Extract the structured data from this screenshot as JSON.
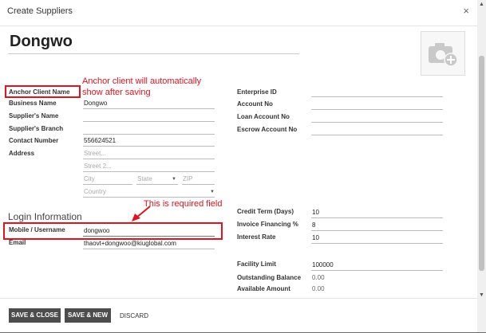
{
  "dialog": {
    "title": "Create Suppliers",
    "close_icon": "×"
  },
  "record_name": "Dongwo",
  "photo": {
    "icon": "camera-add-icon"
  },
  "left_fields": {
    "anchor_client_name": {
      "label": "Anchor Client Name",
      "value": ""
    },
    "business_name": {
      "label": "Business Name",
      "value": "Dongwo"
    },
    "suppliers_name": {
      "label": "Supplier's Name",
      "value": ""
    },
    "suppliers_branch": {
      "label": "Supplier's Branch",
      "value": ""
    },
    "contact_number": {
      "label": "Contact Number",
      "value": "556624521"
    },
    "address": {
      "label": "Address",
      "street_placeholder": "Street...",
      "street2_placeholder": "Street 2...",
      "city_placeholder": "City",
      "state_placeholder": "State",
      "zip_placeholder": "ZIP",
      "country_placeholder": "Country"
    }
  },
  "right_fields": {
    "enterprise_id": {
      "label": "Enterprise ID",
      "value": ""
    },
    "account_no": {
      "label": "Account No",
      "value": ""
    },
    "loan_account_no": {
      "label": "Loan Account No",
      "value": ""
    },
    "escrow_account_no": {
      "label": "Escrow Account No",
      "value": ""
    },
    "credit_term": {
      "label": "Credit Term (Days)",
      "value": "10"
    },
    "invoice_financing": {
      "label": "Invoice Financing %",
      "value": "8"
    },
    "interest_rate": {
      "label": "Interest Rate",
      "value": "10"
    },
    "facility_limit": {
      "label": "Facility Limit",
      "value": "100000"
    },
    "outstanding_balance": {
      "label": "Outstanding Balance",
      "value": "0.00"
    },
    "available_amount": {
      "label": "Available Amount",
      "value": "0.00"
    }
  },
  "login_section": {
    "heading": "Login Information",
    "mobile": {
      "label": "Mobile / Username",
      "value": "dongwoo"
    },
    "email": {
      "label": "Email",
      "value": "thaovt+dongwoo@kiuglobal.com"
    }
  },
  "annotations": {
    "anchor_note_line1": "Anchor client will automatically",
    "anchor_note_line2": "show after saving",
    "required_note": "This is required field",
    "color": "#e0141e"
  },
  "footer": {
    "save_close": "SAVE & CLOSE",
    "save_new": "SAVE & NEW",
    "discard": "DISCARD"
  },
  "colors": {
    "button_bg": "#4c4c4c",
    "annotation": "#e0141e"
  }
}
